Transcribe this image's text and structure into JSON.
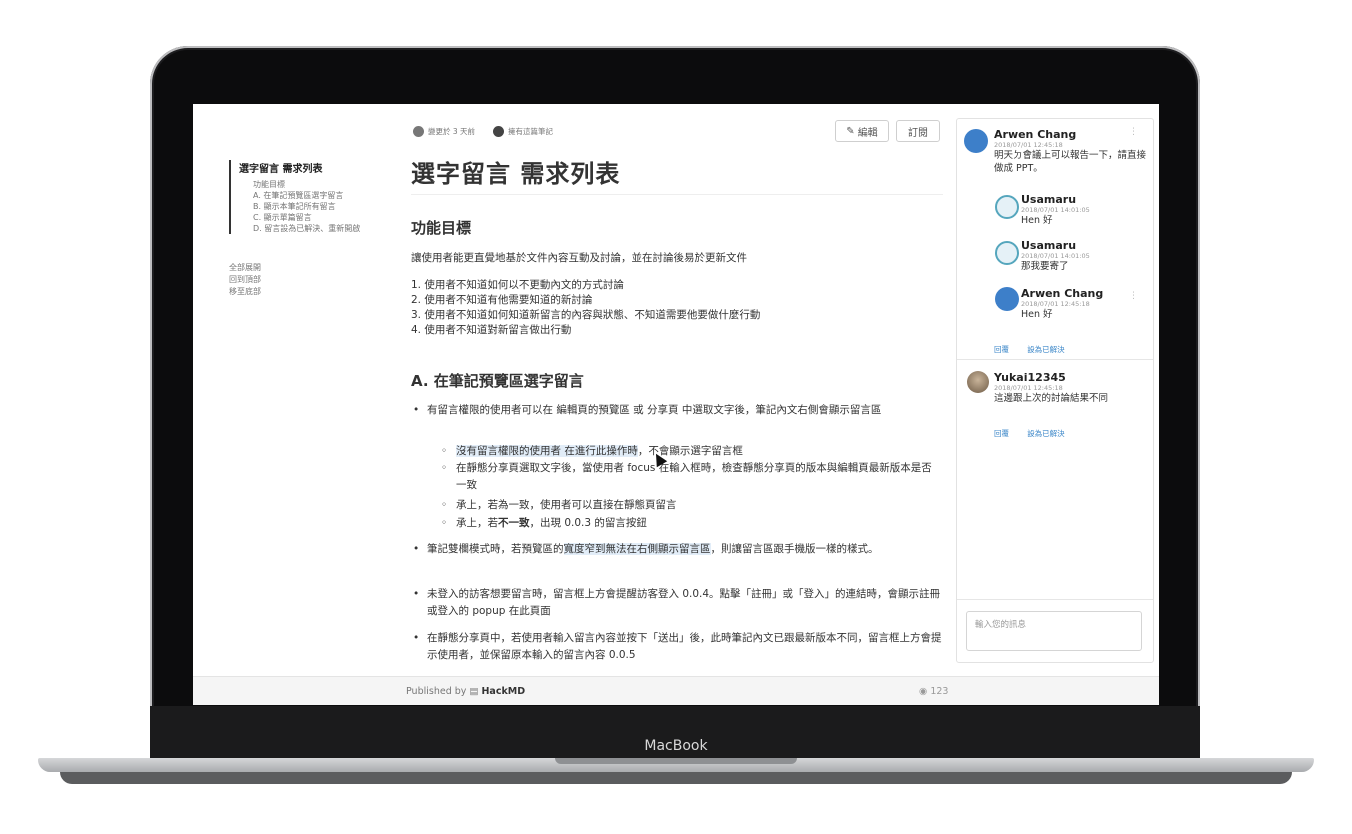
{
  "device_label": "MacBook",
  "toc": {
    "title": "選字留言 需求列表",
    "items": [
      "功能目標",
      "A. 在筆記預覽區選字留言",
      "B. 顯示本筆記所有留言",
      "C. 顯示單篇留言",
      "D. 留言設為已解決、重新開啟"
    ],
    "actions": [
      "全部展開",
      "回到頂部",
      "移至底部"
    ]
  },
  "meta": {
    "changed": "變更於 3 天前",
    "owner": "擁有這篇筆記"
  },
  "buttons": {
    "edit": "編輯",
    "subscribe": "訂閱"
  },
  "doc": {
    "title": "選字留言 需求列表",
    "h_goal": "功能目標",
    "goal_text": "讓使用者能更直覺地基於文件內容互動及討論，並在討論後易於更新文件",
    "goal_list": [
      "1. 使用者不知道如何以不更動內文的方式討論",
      "2. 使用者不知道有他需要知道的新討論",
      "3. 使用者不知道如何知道新留言的內容與狀態、不知道需要他要做什麼行動",
      "4. 使用者不知道對新留言做出行動"
    ],
    "h_a": "A. 在筆記預覽區選字留言",
    "b1": "有留言權限的使用者可以在 編輯頁的預覽區 或 分享頁 中選取文字後，筆記內文右側會顯示留言區",
    "s1_hl": "沒有留言權限的使用者 在進行此操作時",
    "s1_rest": "，不會顯示選字留言框",
    "s2": "在靜態分享頁選取文字後，當使用者 focus 在輸入框時，檢查靜態分享頁的版本與編輯頁最新版本是否一致",
    "s3": "承上，若為一致，使用者可以直接在靜態頁留言",
    "s4_a": "承上，若",
    "s4_b": "不一致",
    "s4_c": "，出現 0.0.3 的留言按鈕",
    "b2_a": "筆記雙欄模式時，若預覽區的",
    "b2_hl": "寬度窄到無法在右側顯示留言區",
    "b2_b": "，則讓留言區跟手機版一樣的樣式。",
    "b3": "未登入的訪客想要留言時，留言框上方會提醒訪客登入 0.0.4。點擊「註冊」或「登入」的連結時，會顯示註冊或登入的 popup 在此頁面",
    "b4": "在靜態分享頁中，若使用者輸入留言內容並按下「送出」後，此時筆記內文已跟最新版本不同，留言框上方會提示使用者，並保留原本輸入的留言內容 0.0.5"
  },
  "footer": {
    "published_by": "Published by",
    "brand": "HackMD",
    "views": "123"
  },
  "comments": {
    "thread1": [
      {
        "name": "Arwen Chang",
        "time": "2018/07/01  12:45:18",
        "body": "明天ㄉ會議上可以報告一下，請直接做成 PPT。"
      },
      {
        "name": "Usamaru",
        "time": "2018/07/01  14:01:05",
        "body": "Hen 好"
      },
      {
        "name": "Usamaru",
        "time": "2018/07/01  14:01:05",
        "body": "那我要寄了"
      },
      {
        "name": "Arwen Chang",
        "time": "2018/07/01  12:45:18",
        "body": "Hen 好"
      }
    ],
    "thread2": [
      {
        "name": "Yukai12345",
        "time": "2018/07/01  12:45:18",
        "body": "這邊跟上次的討論結果不同"
      }
    ],
    "reply": "回覆",
    "resolve": "設為已解決",
    "input_placeholder": "輸入您的訊息"
  },
  "colors": {
    "accent": "#3a86c8",
    "highlight": "#e2edf8"
  }
}
